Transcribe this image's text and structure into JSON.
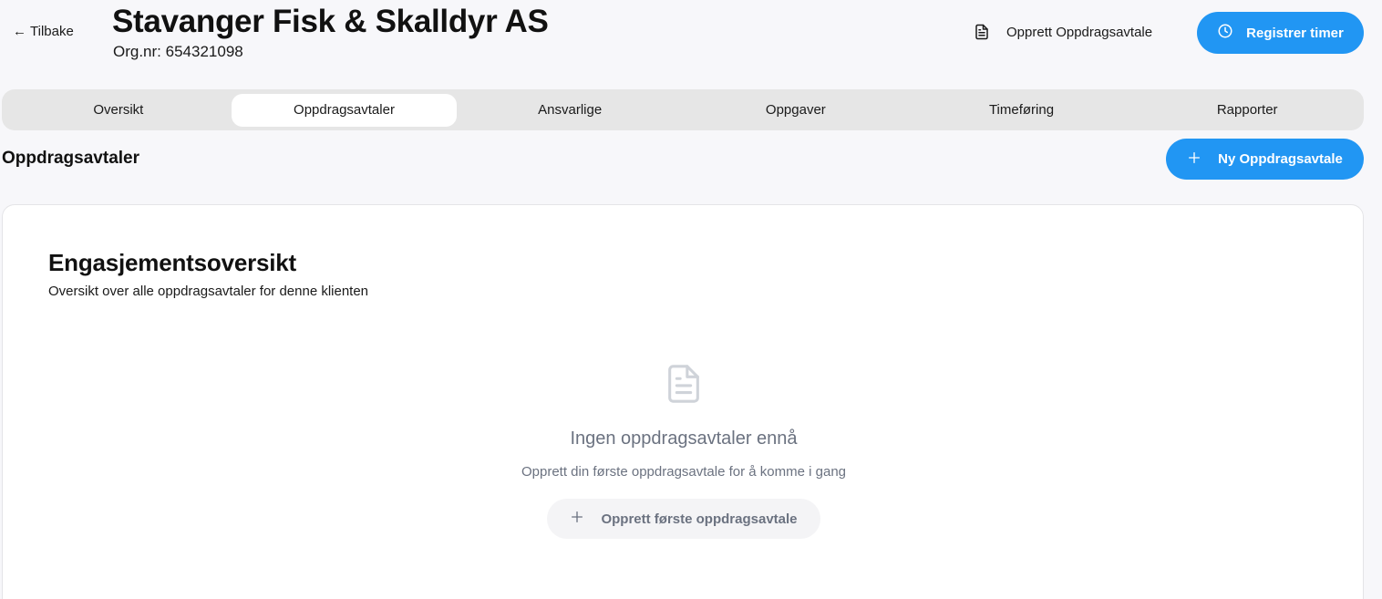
{
  "header": {
    "back_label": "Tilbake",
    "client_name": "Stavanger Fisk & Skalldyr AS",
    "org_label": "Org.nr:",
    "org_number": "654321098",
    "create_agreement_label": "Opprett Oppdragsavtale",
    "register_time_label": "Registrer timer"
  },
  "tabs": [
    {
      "label": "Oversikt",
      "active": false
    },
    {
      "label": "Oppdragsavtaler",
      "active": true
    },
    {
      "label": "Ansvarlige",
      "active": false
    },
    {
      "label": "Oppgaver",
      "active": false
    },
    {
      "label": "Timeføring",
      "active": false
    },
    {
      "label": "Rapporter",
      "active": false
    }
  ],
  "section": {
    "title": "Oppdragsavtaler",
    "new_button_label": "Ny Oppdragsavtale"
  },
  "card": {
    "title": "Engasjementsoversikt",
    "subtitle": "Oversikt over alle oppdragsavtaler for denne klienten",
    "empty_title": "Ingen oppdragsavtaler ennå",
    "empty_subtitle": "Opprett din første oppdragsavtale for å komme i gang",
    "empty_button_label": "Opprett første oppdragsavtale"
  },
  "colors": {
    "primary": "#2196f3",
    "background": "#f7f7fa",
    "muted_text": "#6b7280"
  }
}
